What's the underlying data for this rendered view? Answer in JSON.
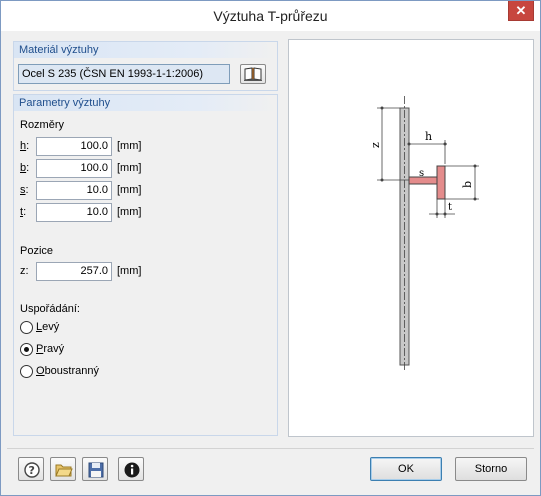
{
  "window": {
    "title": "Výztuha T-průřezu",
    "close_label": "✕"
  },
  "material": {
    "header": "Materiál výztuhy",
    "value": "Ocel S 235 (ČSN EN 1993-1-1:2006)",
    "library_icon": "book-icon"
  },
  "params": {
    "header": "Parametry výztuhy",
    "dimensions_label": "Rozměry",
    "rows": [
      {
        "key": "h",
        "suffix": ":",
        "value": "100.0",
        "unit": "[mm]"
      },
      {
        "key": "b",
        "suffix": ":",
        "value": "100.0",
        "unit": "[mm]"
      },
      {
        "key": "s",
        "suffix": ":",
        "value": "10.0",
        "unit": "[mm]"
      },
      {
        "key": "t",
        "suffix": ":",
        "value": "10.0",
        "unit": "[mm]"
      }
    ],
    "position_label": "Pozice",
    "z_label": "z:",
    "z_value": "257.0",
    "z_unit": "[mm]",
    "arrangement_label": "Uspořádání:",
    "arrangement_options": [
      {
        "first": "L",
        "rest": "evý",
        "selected": false
      },
      {
        "first": "P",
        "rest": "ravý",
        "selected": true
      },
      {
        "first": "O",
        "rest": "boustranný",
        "selected": false
      }
    ]
  },
  "diagram": {
    "labels": {
      "z": "z",
      "h": "h",
      "s": "s",
      "b": "b",
      "t": "t"
    }
  },
  "footer": {
    "tools": [
      "help-icon",
      "open-folder-icon",
      "save-icon",
      "info-icon"
    ],
    "ok_label": "OK",
    "cancel_label": "Storno"
  }
}
